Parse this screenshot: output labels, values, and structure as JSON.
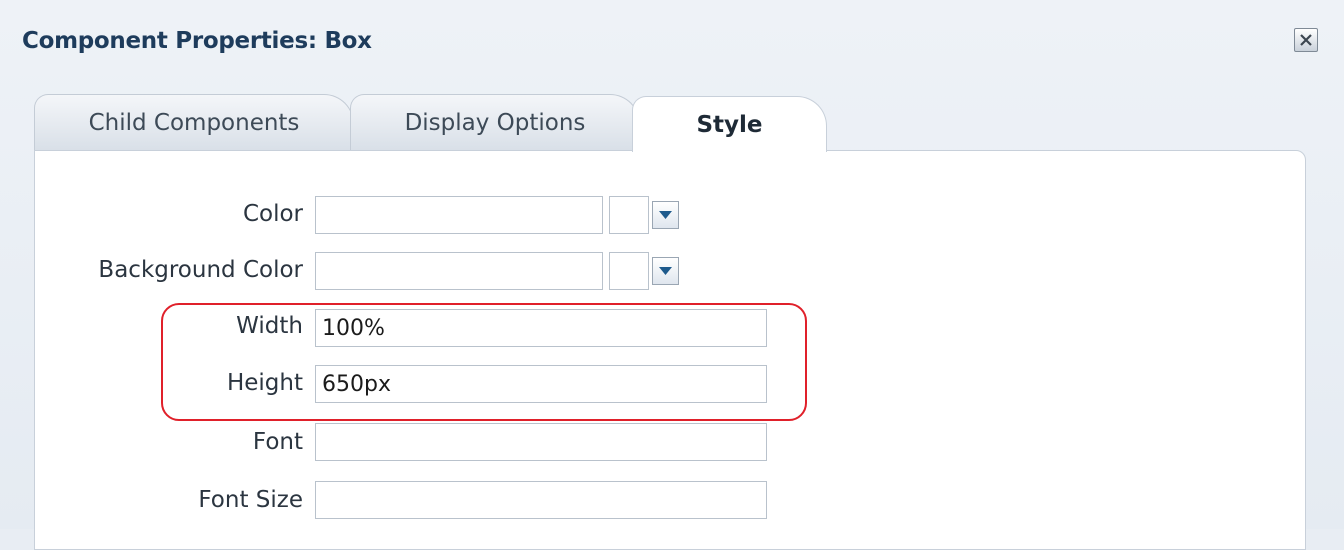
{
  "dialog": {
    "title": "Component Properties: Box",
    "close_icon": "close-icon"
  },
  "tabs": [
    {
      "label": "Child Components",
      "selected": false
    },
    {
      "label": "Display Options",
      "selected": false
    },
    {
      "label": "Style",
      "selected": true
    }
  ],
  "style": {
    "color": {
      "label": "Color",
      "value": ""
    },
    "background_color": {
      "label": "Background Color",
      "value": ""
    },
    "width": {
      "label": "Width",
      "value": "100%"
    },
    "height": {
      "label": "Height",
      "value": "650px"
    },
    "font": {
      "label": "Font",
      "value": ""
    },
    "font_size": {
      "label": "Font Size",
      "value": ""
    }
  },
  "highlight_color": "#e0202a"
}
